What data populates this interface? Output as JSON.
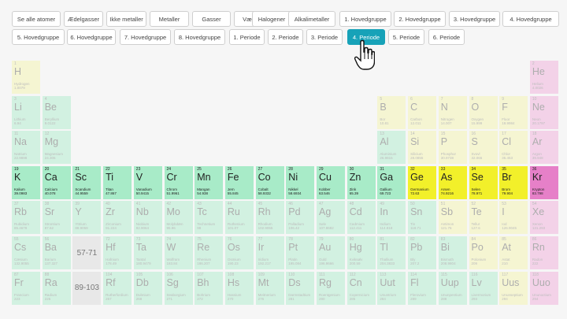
{
  "filters": {
    "row1": [
      "Se alle atomer",
      "Ædelgasser",
      "Ikke metaller",
      "Metaller",
      "Gasser",
      "Væsker",
      "Halogener",
      "Alkalimetaller",
      "1. Hovedgruppe",
      "2. Hovedgruppe",
      "3. Hovedgruppe",
      "4. Hovedgruppe"
    ],
    "row2": [
      "5. Hovedgruppe",
      "6. Hovedgruppe",
      "7. Hovedgruppe",
      "8. Hovedgruppe",
      "1. Periode",
      "2. Periode",
      "3. Periode",
      "4. Periode",
      "5. Periode",
      "6. Periode"
    ],
    "active": "4. Periode"
  },
  "colors": {
    "nonmetal_yellow": "#f5f5a8",
    "halogen_yellow": "#f5f5a8",
    "alkali_green": "#a8ebc8",
    "transition_green": "#a8ebc8",
    "metalloid_yellow": "#f5f5a8",
    "noble_pink": "#f0a8d8",
    "active_button": "#17a2b8",
    "placeholder_gray": "#e8e8e8"
  },
  "placeholders": {
    "lanthanides": "57-71",
    "actinides": "89-103"
  },
  "elements": [
    {
      "n": "1",
      "s": "H",
      "name": "Hydrogen",
      "w": "1.0079",
      "row": 1,
      "col": 1,
      "c": "y"
    },
    {
      "n": "2",
      "s": "He",
      "name": "Helium",
      "w": "4.0026",
      "row": 1,
      "col": 18,
      "c": "p"
    },
    {
      "n": "3",
      "s": "Li",
      "name": "Lithium",
      "w": "6.94",
      "row": 2,
      "col": 1,
      "c": "g"
    },
    {
      "n": "4",
      "s": "Be",
      "name": "Beryllium",
      "w": "9.0122",
      "row": 2,
      "col": 2,
      "c": "g"
    },
    {
      "n": "5",
      "s": "B",
      "name": "Bor",
      "w": "10.81",
      "row": 2,
      "col": 13,
      "c": "y"
    },
    {
      "n": "6",
      "s": "C",
      "name": "Carbon",
      "w": "12.011",
      "row": 2,
      "col": 14,
      "c": "y"
    },
    {
      "n": "7",
      "s": "N",
      "name": "Nitrogen",
      "w": "14.007",
      "row": 2,
      "col": 15,
      "c": "y"
    },
    {
      "n": "8",
      "s": "O",
      "name": "Oxygen",
      "w": "15.999",
      "row": 2,
      "col": 16,
      "c": "y"
    },
    {
      "n": "9",
      "s": "F",
      "name": "Fluor",
      "w": "18.9984",
      "row": 2,
      "col": 17,
      "c": "y"
    },
    {
      "n": "10",
      "s": "Ne",
      "name": "Neon",
      "w": "20.1797",
      "row": 2,
      "col": 18,
      "c": "p"
    },
    {
      "n": "11",
      "s": "Na",
      "name": "Natrium",
      "w": "22.9898",
      "row": 3,
      "col": 1,
      "c": "g"
    },
    {
      "n": "12",
      "s": "Mg",
      "name": "Magnesium",
      "w": "24.305",
      "row": 3,
      "col": 2,
      "c": "g"
    },
    {
      "n": "13",
      "s": "Al",
      "name": "Aluminium",
      "w": "26.9815",
      "row": 3,
      "col": 13,
      "c": "g"
    },
    {
      "n": "14",
      "s": "Si",
      "name": "Silicium",
      "w": "28.0855",
      "row": 3,
      "col": 14,
      "c": "y"
    },
    {
      "n": "15",
      "s": "P",
      "name": "Phosphor",
      "w": "30.9738",
      "row": 3,
      "col": 15,
      "c": "y"
    },
    {
      "n": "16",
      "s": "S",
      "name": "Svovl",
      "w": "32.065",
      "row": 3,
      "col": 16,
      "c": "y"
    },
    {
      "n": "17",
      "s": "Cl",
      "name": "Chlor",
      "w": "35.453",
      "row": 3,
      "col": 17,
      "c": "y"
    },
    {
      "n": "18",
      "s": "Ar",
      "name": "Argon",
      "w": "39.948",
      "row": 3,
      "col": 18,
      "c": "p"
    },
    {
      "n": "19",
      "s": "K",
      "name": "Kalium",
      "w": "39.0983",
      "row": 4,
      "col": 1,
      "c": "g"
    },
    {
      "n": "20",
      "s": "Ca",
      "name": "Calcium",
      "w": "40.078",
      "row": 4,
      "col": 2,
      "c": "g"
    },
    {
      "n": "21",
      "s": "Sc",
      "name": "Scandium",
      "w": "44.9559",
      "row": 4,
      "col": 3,
      "c": "g"
    },
    {
      "n": "22",
      "s": "Ti",
      "name": "Titan",
      "w": "47.867",
      "row": 4,
      "col": 4,
      "c": "g"
    },
    {
      "n": "23",
      "s": "V",
      "name": "Vanadium",
      "w": "50.9415",
      "row": 4,
      "col": 5,
      "c": "g"
    },
    {
      "n": "24",
      "s": "Cr",
      "name": "Chrom",
      "w": "51.9961",
      "row": 4,
      "col": 6,
      "c": "g"
    },
    {
      "n": "25",
      "s": "Mn",
      "name": "Mangan",
      "w": "54.938",
      "row": 4,
      "col": 7,
      "c": "g"
    },
    {
      "n": "26",
      "s": "Fe",
      "name": "Jern",
      "w": "55.845",
      "row": 4,
      "col": 8,
      "c": "g"
    },
    {
      "n": "27",
      "s": "Co",
      "name": "Cobalt",
      "w": "58.9332",
      "row": 4,
      "col": 9,
      "c": "g"
    },
    {
      "n": "28",
      "s": "Ni",
      "name": "Nikkel",
      "w": "58.6934",
      "row": 4,
      "col": 10,
      "c": "g"
    },
    {
      "n": "29",
      "s": "Cu",
      "name": "Kobber",
      "w": "63.546",
      "row": 4,
      "col": 11,
      "c": "g"
    },
    {
      "n": "30",
      "s": "Zn",
      "name": "Zink",
      "w": "65.39",
      "row": 4,
      "col": 12,
      "c": "g"
    },
    {
      "n": "31",
      "s": "Ga",
      "name": "Gallium",
      "w": "69.723",
      "row": 4,
      "col": 13,
      "c": "g"
    },
    {
      "n": "32",
      "s": "Ge",
      "name": "Germanium",
      "w": "72.63",
      "row": 4,
      "col": 14,
      "c": "Y"
    },
    {
      "n": "33",
      "s": "As",
      "name": "Arsen",
      "w": "74.9216",
      "row": 4,
      "col": 15,
      "c": "Y"
    },
    {
      "n": "34",
      "s": "Se",
      "name": "Selen",
      "w": "78.971",
      "row": 4,
      "col": 16,
      "c": "Y"
    },
    {
      "n": "35",
      "s": "Br",
      "name": "Brom",
      "w": "79.904",
      "row": 4,
      "col": 17,
      "c": "Y"
    },
    {
      "n": "36",
      "s": "Kr",
      "name": "Krypton",
      "w": "83.798",
      "row": 4,
      "col": 18,
      "c": "P"
    },
    {
      "n": "37",
      "s": "Rb",
      "name": "Rubidium",
      "w": "85.4678",
      "row": 5,
      "col": 1,
      "c": "g"
    },
    {
      "n": "38",
      "s": "Sr",
      "name": "Strontium",
      "w": "87.62",
      "row": 5,
      "col": 2,
      "c": "g"
    },
    {
      "n": "39",
      "s": "Y",
      "name": "Yttrium",
      "w": "88.9059",
      "row": 5,
      "col": 3,
      "c": "g"
    },
    {
      "n": "40",
      "s": "Zr",
      "name": "Zirconium",
      "w": "91.224",
      "row": 5,
      "col": 4,
      "c": "g"
    },
    {
      "n": "41",
      "s": "Nb",
      "name": "Niobium",
      "w": "92.9064",
      "row": 5,
      "col": 5,
      "c": "g"
    },
    {
      "n": "42",
      "s": "Mo",
      "name": "Molybdæn",
      "w": "95.96",
      "row": 5,
      "col": 6,
      "c": "g"
    },
    {
      "n": "43",
      "s": "Tc",
      "name": "Technetium",
      "w": "98",
      "row": 5,
      "col": 7,
      "c": "g"
    },
    {
      "n": "44",
      "s": "Ru",
      "name": "Ruthenium",
      "w": "101.07",
      "row": 5,
      "col": 8,
      "c": "g"
    },
    {
      "n": "45",
      "s": "Rh",
      "name": "Rhodium",
      "w": "102.9055",
      "row": 5,
      "col": 9,
      "c": "g"
    },
    {
      "n": "46",
      "s": "Pd",
      "name": "Palladium",
      "w": "106.42",
      "row": 5,
      "col": 10,
      "c": "g"
    },
    {
      "n": "47",
      "s": "Ag",
      "name": "Sølv",
      "w": "107.8682",
      "row": 5,
      "col": 11,
      "c": "g"
    },
    {
      "n": "48",
      "s": "Cd",
      "name": "Cadmium",
      "w": "112.411",
      "row": 5,
      "col": 12,
      "c": "g"
    },
    {
      "n": "49",
      "s": "In",
      "name": "Indium",
      "w": "114.818",
      "row": 5,
      "col": 13,
      "c": "g"
    },
    {
      "n": "50",
      "s": "Sn",
      "name": "Tin",
      "w": "118.71",
      "row": 5,
      "col": 14,
      "c": "g"
    },
    {
      "n": "51",
      "s": "Sb",
      "name": "Antimon",
      "w": "121.76",
      "row": 5,
      "col": 15,
      "c": "y"
    },
    {
      "n": "52",
      "s": "Te",
      "name": "Tellur",
      "w": "127.6",
      "row": 5,
      "col": 16,
      "c": "y"
    },
    {
      "n": "53",
      "s": "I",
      "name": "Iod",
      "w": "126.9045",
      "row": 5,
      "col": 17,
      "c": "y"
    },
    {
      "n": "54",
      "s": "Xe",
      "name": "Xenon",
      "w": "131.293",
      "row": 5,
      "col": 18,
      "c": "p"
    },
    {
      "n": "55",
      "s": "Cs",
      "name": "Cæsium",
      "w": "132.9055",
      "row": 6,
      "col": 1,
      "c": "g"
    },
    {
      "n": "56",
      "s": "Ba",
      "name": "Barium",
      "w": "137.327",
      "row": 6,
      "col": 2,
      "c": "g"
    },
    {
      "n": "72",
      "s": "Hf",
      "name": "Hafnium",
      "w": "178.49",
      "row": 6,
      "col": 4,
      "c": "g"
    },
    {
      "n": "73",
      "s": "Ta",
      "name": "Tantal",
      "w": "180.9479",
      "row": 6,
      "col": 5,
      "c": "g"
    },
    {
      "n": "74",
      "s": "W",
      "name": "Wolfram",
      "w": "183.84",
      "row": 6,
      "col": 6,
      "c": "g"
    },
    {
      "n": "75",
      "s": "Re",
      "name": "Rhenium",
      "w": "186.207",
      "row": 6,
      "col": 7,
      "c": "g"
    },
    {
      "n": "76",
      "s": "Os",
      "name": "Osmium",
      "w": "190.23",
      "row": 6,
      "col": 8,
      "c": "g"
    },
    {
      "n": "77",
      "s": "Ir",
      "name": "Iridium",
      "w": "192.217",
      "row": 6,
      "col": 9,
      "c": "g"
    },
    {
      "n": "78",
      "s": "Pt",
      "name": "Platin",
      "w": "195.084",
      "row": 6,
      "col": 10,
      "c": "g"
    },
    {
      "n": "79",
      "s": "Au",
      "name": "Guld",
      "w": "196.9666",
      "row": 6,
      "col": 11,
      "c": "g"
    },
    {
      "n": "80",
      "s": "Hg",
      "name": "Kviksølv",
      "w": "200.59",
      "row": 6,
      "col": 12,
      "c": "g"
    },
    {
      "n": "81",
      "s": "Tl",
      "name": "Thallium",
      "w": "204.3833",
      "row": 6,
      "col": 13,
      "c": "g"
    },
    {
      "n": "82",
      "s": "Pb",
      "name": "Bly",
      "w": "207.2",
      "row": 6,
      "col": 14,
      "c": "g"
    },
    {
      "n": "83",
      "s": "Bi",
      "name": "Bismuth",
      "w": "208.9804",
      "row": 6,
      "col": 15,
      "c": "g"
    },
    {
      "n": "84",
      "s": "Po",
      "name": "Polonium",
      "w": "209",
      "row": 6,
      "col": 16,
      "c": "y"
    },
    {
      "n": "85",
      "s": "At",
      "name": "Astat",
      "w": "210",
      "row": 6,
      "col": 17,
      "c": "y"
    },
    {
      "n": "86",
      "s": "Rn",
      "name": "Radon",
      "w": "222",
      "row": 6,
      "col": 18,
      "c": "p"
    },
    {
      "n": "87",
      "s": "Fr",
      "name": "Francium",
      "w": "223",
      "row": 7,
      "col": 1,
      "c": "g"
    },
    {
      "n": "88",
      "s": "Ra",
      "name": "Radium",
      "w": "226",
      "row": 7,
      "col": 2,
      "c": "g"
    },
    {
      "n": "104",
      "s": "Rf",
      "name": "Rutherfordium",
      "w": "267",
      "row": 7,
      "col": 4,
      "c": "g"
    },
    {
      "n": "105",
      "s": "Db",
      "name": "Dubnium",
      "w": "268",
      "row": 7,
      "col": 5,
      "c": "g"
    },
    {
      "n": "106",
      "s": "Sg",
      "name": "Seaborgium",
      "w": "271",
      "row": 7,
      "col": 6,
      "c": "g"
    },
    {
      "n": "107",
      "s": "Bh",
      "name": "Bohrium",
      "w": "272",
      "row": 7,
      "col": 7,
      "c": "g"
    },
    {
      "n": "108",
      "s": "Hs",
      "name": "Hassium",
      "w": "270",
      "row": 7,
      "col": 8,
      "c": "g"
    },
    {
      "n": "109",
      "s": "Mt",
      "name": "Meitnerium",
      "w": "276",
      "row": 7,
      "col": 9,
      "c": "g"
    },
    {
      "n": "110",
      "s": "Ds",
      "name": "Darmstadtium",
      "w": "281",
      "row": 7,
      "col": 10,
      "c": "g"
    },
    {
      "n": "111",
      "s": "Rg",
      "name": "Roentgenium",
      "w": "280",
      "row": 7,
      "col": 11,
      "c": "g"
    },
    {
      "n": "112",
      "s": "Cn",
      "name": "Copernicium",
      "w": "285",
      "row": 7,
      "col": 12,
      "c": "g"
    },
    {
      "n": "113",
      "s": "Uut",
      "name": "Ununtrium",
      "w": "284",
      "row": 7,
      "col": 13,
      "c": "g"
    },
    {
      "n": "114",
      "s": "Fl",
      "name": "Flerovium",
      "w": "289",
      "row": 7,
      "col": 14,
      "c": "g"
    },
    {
      "n": "115",
      "s": "Uup",
      "name": "Ununpentium",
      "w": "288",
      "row": 7,
      "col": 15,
      "c": "g"
    },
    {
      "n": "116",
      "s": "Lv",
      "name": "Livermorium",
      "w": "293",
      "row": 7,
      "col": 16,
      "c": "g"
    },
    {
      "n": "117",
      "s": "Uus",
      "name": "Ununseptium",
      "w": "294",
      "row": 7,
      "col": 17,
      "c": "y"
    },
    {
      "n": "118",
      "s": "Uuo",
      "name": "Ununoctium",
      "w": "294",
      "row": 7,
      "col": 18,
      "c": "p"
    }
  ]
}
